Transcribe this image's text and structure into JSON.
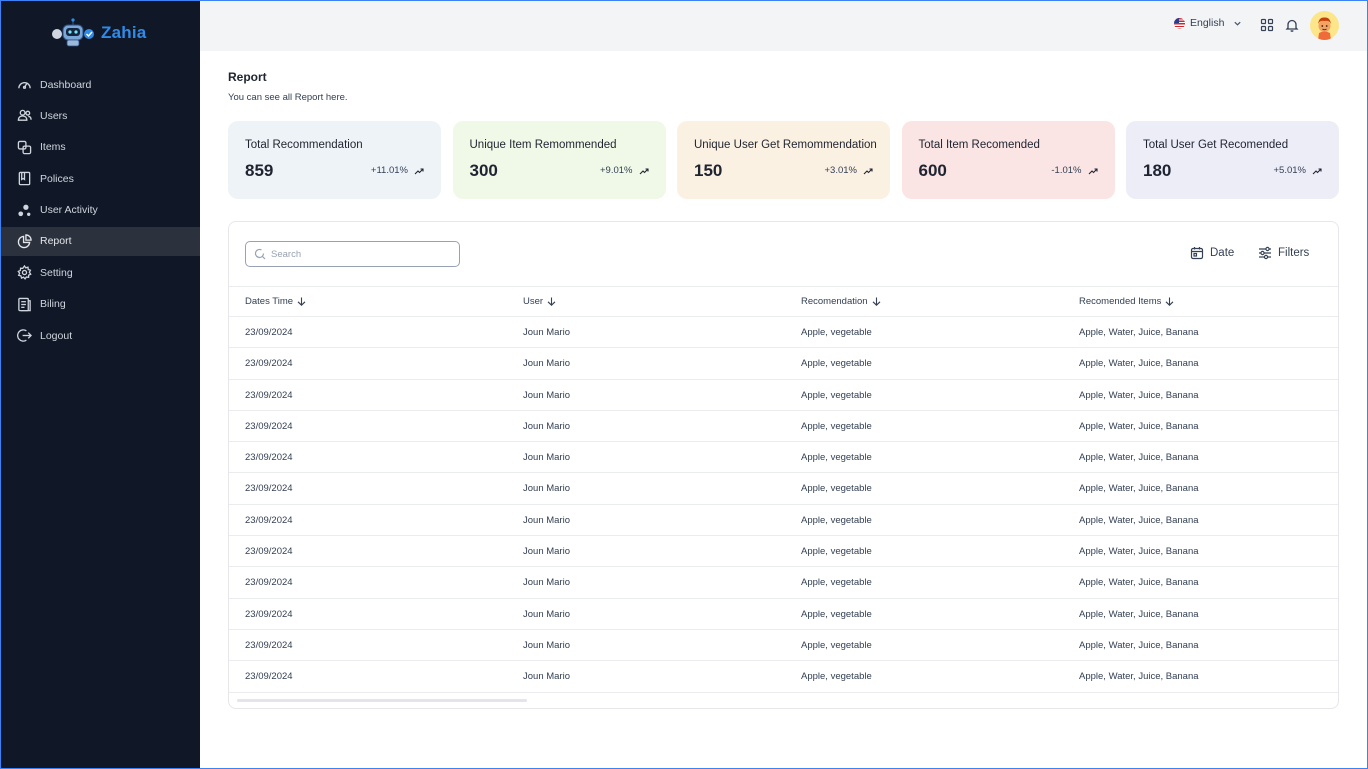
{
  "brand": {
    "name": "Zahia"
  },
  "sidebar": {
    "items": [
      {
        "label": "Dashboard",
        "icon": "dashboard-icon"
      },
      {
        "label": "Users",
        "icon": "users-icon"
      },
      {
        "label": "Items",
        "icon": "items-icon"
      },
      {
        "label": "Polices",
        "icon": "book-icon"
      },
      {
        "label": "User Activity",
        "icon": "activity-icon"
      },
      {
        "label": "Report",
        "icon": "pie-chart-icon",
        "active": true
      },
      {
        "label": "Setting",
        "icon": "gear-icon"
      },
      {
        "label": "Biling",
        "icon": "billing-icon"
      },
      {
        "label": "Logout",
        "icon": "logout-icon"
      }
    ]
  },
  "topbar": {
    "language": "English",
    "icons": [
      "apps-grid-icon",
      "bell-icon",
      "avatar"
    ]
  },
  "page": {
    "title": "Report",
    "subtitle": "You can see all Report here."
  },
  "stats": [
    {
      "title": "Total Recommendation",
      "value": "859",
      "delta": "+11.01%",
      "bg": "#eef3f8"
    },
    {
      "title": "Unique Item Remommended",
      "value": "300",
      "delta": "+9.01%",
      "bg": "#f0f9e8"
    },
    {
      "title": "Unique User Get Remommendation",
      "value": "150",
      "delta": "+3.01%",
      "bg": "#fbf1e2"
    },
    {
      "title": "Total Item Recomended",
      "value": "600",
      "delta": "-1.01%",
      "bg": "#fae4e4"
    },
    {
      "title": "Total User Get Recomended",
      "value": "180",
      "delta": "+5.01%",
      "bg": "#ededf8"
    }
  ],
  "table": {
    "search_placeholder": "Search",
    "date_label": "Date",
    "filters_label": "Filters",
    "columns": [
      "Dates Time",
      "User",
      "Recomendation",
      "Recomended Items"
    ],
    "rows": [
      [
        "23/09/2024",
        "Joun Mario",
        "Apple, vegetable",
        "Apple, Water, Juice, Banana"
      ],
      [
        "23/09/2024",
        "Joun Mario",
        "Apple, vegetable",
        "Apple, Water, Juice, Banana"
      ],
      [
        "23/09/2024",
        "Joun Mario",
        "Apple, vegetable",
        "Apple, Water, Juice, Banana"
      ],
      [
        "23/09/2024",
        "Joun Mario",
        "Apple, vegetable",
        "Apple, Water, Juice, Banana"
      ],
      [
        "23/09/2024",
        "Joun Mario",
        "Apple, vegetable",
        "Apple, Water, Juice, Banana"
      ],
      [
        "23/09/2024",
        "Joun Mario",
        "Apple, vegetable",
        "Apple, Water, Juice, Banana"
      ],
      [
        "23/09/2024",
        "Joun Mario",
        "Apple, vegetable",
        "Apple, Water, Juice, Banana"
      ],
      [
        "23/09/2024",
        "Joun Mario",
        "Apple, vegetable",
        "Apple, Water, Juice, Banana"
      ],
      [
        "23/09/2024",
        "Joun Mario",
        "Apple, vegetable",
        "Apple, Water, Juice, Banana"
      ],
      [
        "23/09/2024",
        "Joun Mario",
        "Apple, vegetable",
        "Apple, Water, Juice, Banana"
      ],
      [
        "23/09/2024",
        "Joun Mario",
        "Apple, vegetable",
        "Apple, Water, Juice, Banana"
      ],
      [
        "23/09/2024",
        "Joun Mario",
        "Apple, vegetable",
        "Apple, Water, Juice, Banana"
      ]
    ]
  },
  "colors": {
    "sidebar_bg": "#101828",
    "accent": "#2e8be8",
    "topbar_bg": "#f3f4f6"
  }
}
